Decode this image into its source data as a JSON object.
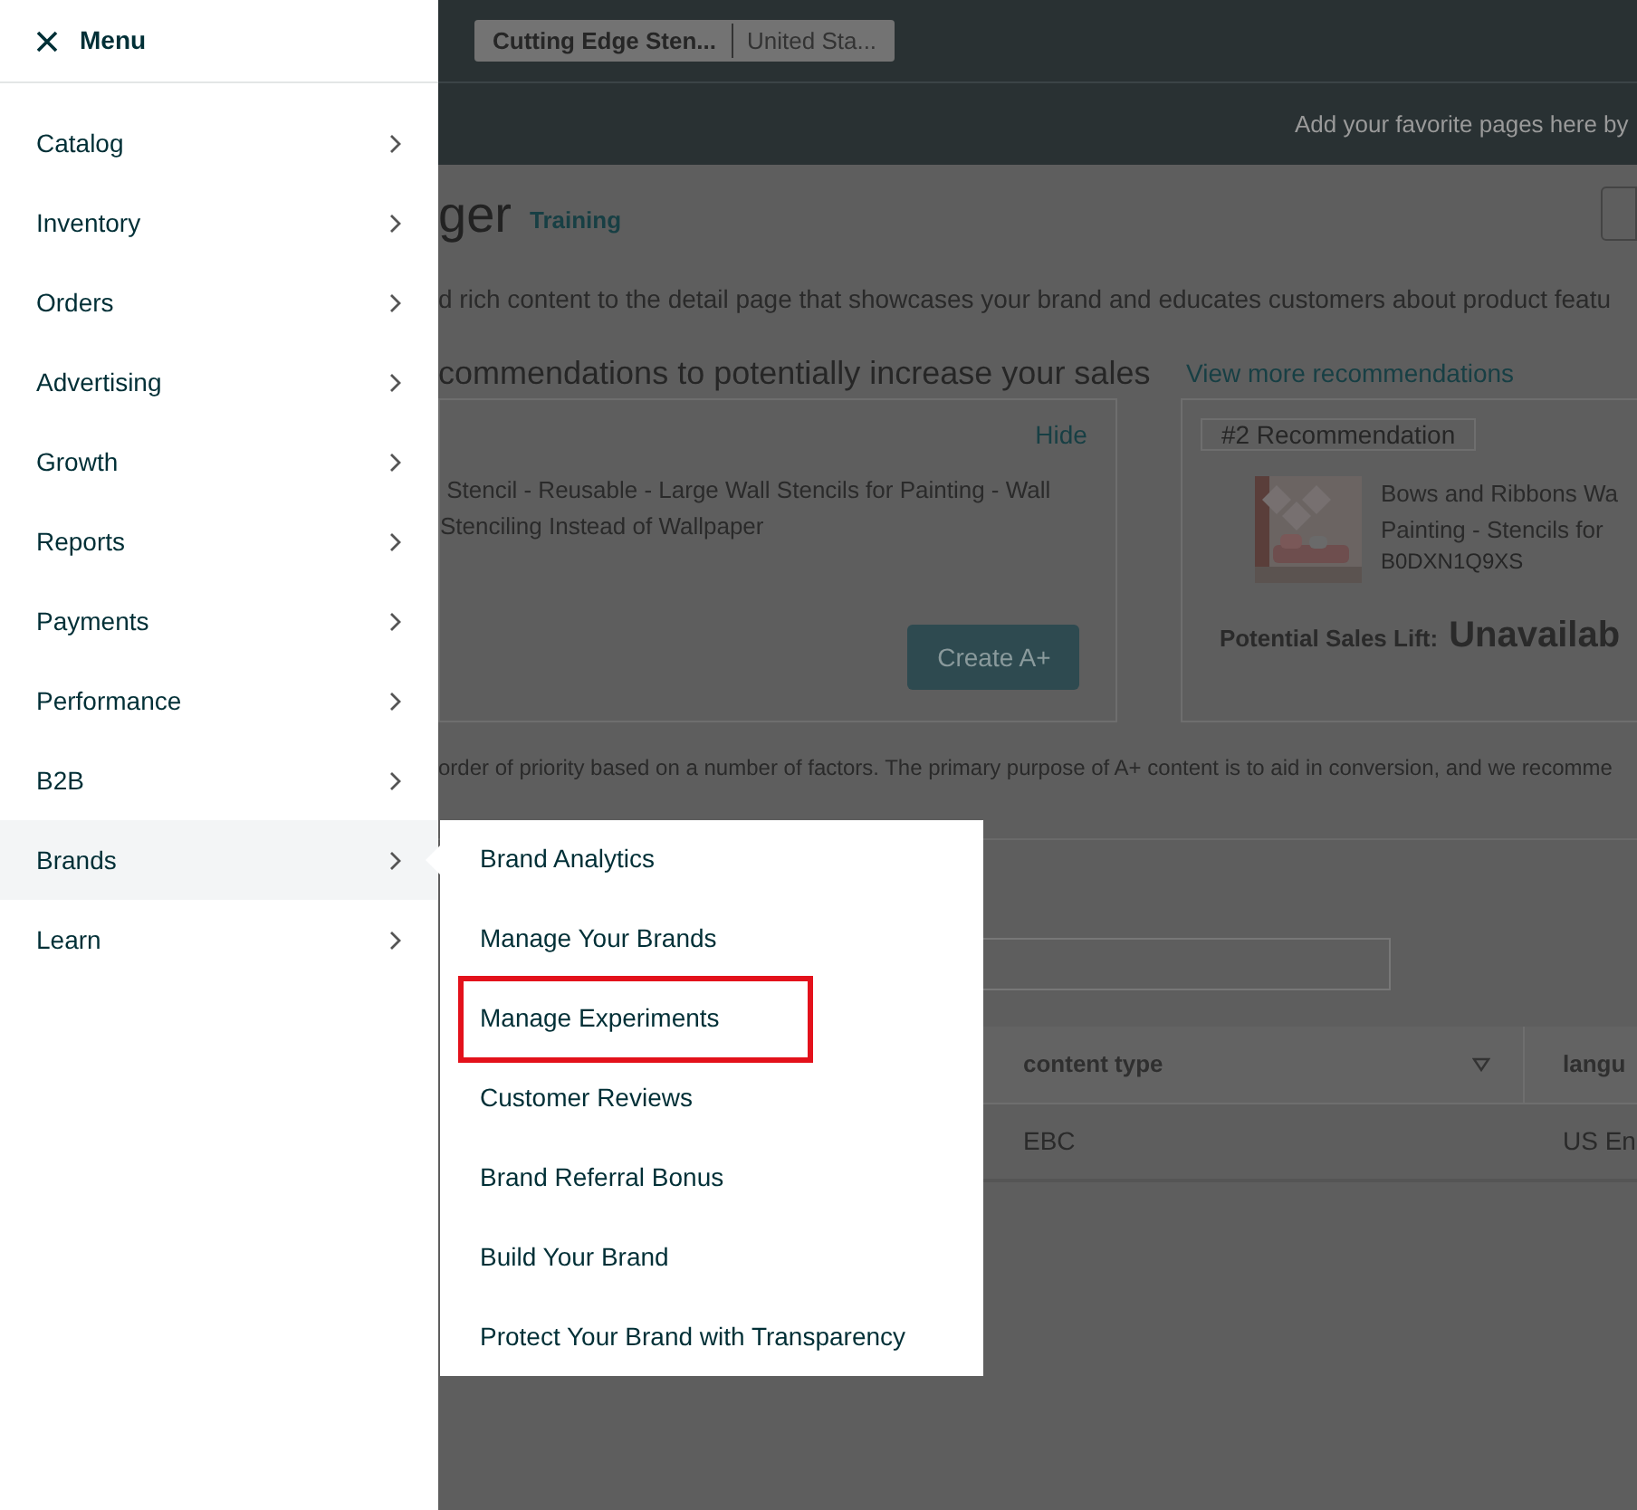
{
  "header": {
    "store": "Cutting Edge Sten...",
    "marketplace": "United Sta..."
  },
  "favorites_bar": {
    "text": "Add your favorite pages here by"
  },
  "page": {
    "title": "ger",
    "badge": "Training",
    "description": "d rich content to the detail page that showcases your brand and educates customers about product featu",
    "recommendations_heading": "commendations to potentially increase your sales",
    "view_more": "View more recommendations"
  },
  "recommendation_cards": [
    {
      "kind": "first",
      "hide": "Hide",
      "title_lines": [
        " Stencil - Reusable - Large Wall Stencils for Painting - Wall",
        "Stenciling Instead of Wallpaper"
      ],
      "button": "Create A+"
    },
    {
      "kind": "second",
      "label": "#2 Recommendation",
      "title_lines": [
        "Bows and Ribbons Wa",
        "Painting - Stencils for"
      ],
      "asin": "B0DXN1Q9XS",
      "lift_label": "Potential Sales Lift:",
      "lift_value": "Unavailab"
    }
  ],
  "footnote": "order of priority based on a number of factors. The primary purpose of A+ content is to aid in conversion, and we recomme",
  "table": {
    "columns": [
      "content type",
      "langu"
    ],
    "rows": [
      [
        "EBC",
        "US En"
      ]
    ]
  },
  "menu": {
    "title": "Menu",
    "items": [
      {
        "label": "Catalog",
        "selected": false
      },
      {
        "label": "Inventory",
        "selected": false
      },
      {
        "label": "Orders",
        "selected": false
      },
      {
        "label": "Advertising",
        "selected": false
      },
      {
        "label": "Growth",
        "selected": false
      },
      {
        "label": "Reports",
        "selected": false
      },
      {
        "label": "Payments",
        "selected": false
      },
      {
        "label": "Performance",
        "selected": false
      },
      {
        "label": "B2B",
        "selected": false
      },
      {
        "label": "Brands",
        "selected": true
      },
      {
        "label": "Learn",
        "selected": false
      }
    ]
  },
  "submenu": {
    "items": [
      {
        "label": "Brand Analytics",
        "highlighted": false
      },
      {
        "label": "Manage Your Brands",
        "highlighted": false
      },
      {
        "label": "Manage Experiments",
        "highlighted": true
      },
      {
        "label": "Customer Reviews",
        "highlighted": false
      },
      {
        "label": "Brand Referral Bonus",
        "highlighted": false
      },
      {
        "label": "Build Your Brand",
        "highlighted": false
      },
      {
        "label": "Protect Your Brand with Transparency",
        "highlighted": false
      }
    ]
  }
}
